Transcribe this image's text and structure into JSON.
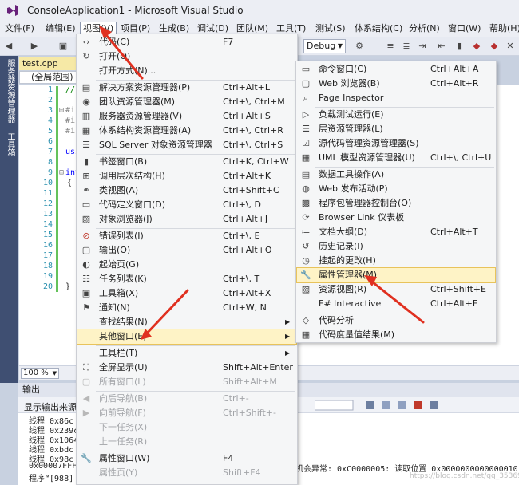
{
  "window": {
    "title": "ConsoleApplication1 - Microsoft Visual Studio"
  },
  "menubar": [
    "文件(F)",
    "编辑(E)",
    "视图(V)",
    "项目(P)",
    "生成(B)",
    "调试(D)",
    "团队(M)",
    "工具(T)",
    "测试(S)",
    "体系结构(C)",
    "分析(N)",
    "窗口(W)",
    "帮助(H)"
  ],
  "toolbar": {
    "config": "Debug"
  },
  "side_panels": [
    "服务器资源管理器",
    "工具箱"
  ],
  "editor": {
    "tab": "test.cpp",
    "scope": "(全局范围)",
    "line_numbers": [
      "1",
      "2",
      "3",
      "4",
      "5",
      "6",
      "7",
      "8",
      "9",
      "10",
      "11",
      "12",
      "13",
      "14",
      "15",
      "16",
      "17",
      "18",
      "19",
      "20"
    ],
    "code_fragments": [
      "//",
      "#ir",
      "#ir",
      "#ir",
      "usi",
      "int",
      "{",
      "}"
    ],
    "zoom": "100 %"
  },
  "view_menu": {
    "items": [
      {
        "label": "代码(C)",
        "shortcut": "F7",
        "icon": "code-icon"
      },
      {
        "label": "打开(O)",
        "shortcut": "",
        "icon": "open-icon"
      },
      {
        "label": "打开方式(N)...",
        "shortcut": "",
        "icon": ""
      },
      {
        "label": "解决方案资源管理器(P)",
        "shortcut": "Ctrl+Alt+L",
        "icon": "solution-explorer-icon"
      },
      {
        "label": "团队资源管理器(M)",
        "shortcut": "Ctrl+\\, Ctrl+M",
        "icon": "team-explorer-icon"
      },
      {
        "label": "服务器资源管理器(V)",
        "shortcut": "Ctrl+Alt+S",
        "icon": "server-explorer-icon"
      },
      {
        "label": "体系结构资源管理器(A)",
        "shortcut": "Ctrl+\\, Ctrl+R",
        "icon": "architecture-explorer-icon"
      },
      {
        "label": "SQL Server 对象资源管理器",
        "shortcut": "Ctrl+\\, Ctrl+S",
        "icon": "sql-server-icon"
      },
      {
        "label": "书签窗口(B)",
        "shortcut": "Ctrl+K, Ctrl+W",
        "icon": "bookmark-icon"
      },
      {
        "label": "调用层次结构(H)",
        "shortcut": "Ctrl+Alt+K",
        "icon": "call-hierarchy-icon"
      },
      {
        "label": "类视图(A)",
        "shortcut": "Ctrl+Shift+C",
        "icon": "class-view-icon"
      },
      {
        "label": "代码定义窗口(D)",
        "shortcut": "Ctrl+\\, D",
        "icon": "code-definition-icon"
      },
      {
        "label": "对象浏览器(J)",
        "shortcut": "Ctrl+Alt+J",
        "icon": "object-browser-icon"
      },
      {
        "label": "错误列表(I)",
        "shortcut": "Ctrl+\\, E",
        "icon": "error-list-icon"
      },
      {
        "label": "输出(O)",
        "shortcut": "Ctrl+Alt+O",
        "icon": "output-icon"
      },
      {
        "label": "起始页(G)",
        "shortcut": "",
        "icon": "start-page-icon"
      },
      {
        "label": "任务列表(K)",
        "shortcut": "Ctrl+\\, T",
        "icon": "task-list-icon"
      },
      {
        "label": "工具箱(X)",
        "shortcut": "Ctrl+Alt+X",
        "icon": "toolbox-icon"
      },
      {
        "label": "通知(N)",
        "shortcut": "Ctrl+W, N",
        "icon": "notification-icon"
      },
      {
        "label": "查找结果(N)",
        "shortcut": "",
        "icon": ""
      },
      {
        "label": "其他窗口(E)",
        "shortcut": "",
        "icon": ""
      },
      {
        "label": "工具栏(T)",
        "shortcut": "",
        "icon": ""
      },
      {
        "label": "全屏显示(U)",
        "shortcut": "Shift+Alt+Enter",
        "icon": "fullscreen-icon"
      },
      {
        "label": "所有窗口(L)",
        "shortcut": "Shift+Alt+M",
        "icon": "all-windows-icon"
      },
      {
        "label": "向后导航(B)",
        "shortcut": "Ctrl+-",
        "icon": "navigate-back-icon"
      },
      {
        "label": "向前导航(F)",
        "shortcut": "Ctrl+Shift+-",
        "icon": "navigate-forward-icon"
      },
      {
        "label": "下一任务(X)",
        "shortcut": "",
        "icon": ""
      },
      {
        "label": "上一任务(R)",
        "shortcut": "",
        "icon": ""
      },
      {
        "label": "属性窗口(W)",
        "shortcut": "F4",
        "icon": "properties-window-icon"
      },
      {
        "label": "属性页(Y)",
        "shortcut": "Shift+F4",
        "icon": ""
      }
    ]
  },
  "other_windows_menu": {
    "items": [
      {
        "label": "命令窗口(C)",
        "shortcut": "Ctrl+Alt+A",
        "icon": "command-window-icon"
      },
      {
        "label": "Web 浏览器(B)",
        "shortcut": "Ctrl+Alt+R",
        "icon": "web-browser-icon"
      },
      {
        "label": "Page Inspector",
        "shortcut": "",
        "icon": "page-inspector-icon"
      },
      {
        "label": "负载测试运行(E)",
        "shortcut": "",
        "icon": "load-test-icon"
      },
      {
        "label": "层资源管理器(L)",
        "shortcut": "",
        "icon": "layer-explorer-icon"
      },
      {
        "label": "源代码管理资源管理器(S)",
        "shortcut": "",
        "icon": "source-control-icon"
      },
      {
        "label": "UML 模型资源管理器(U)",
        "shortcut": "Ctrl+\\, Ctrl+U",
        "icon": "uml-model-icon"
      },
      {
        "label": "数据工具操作(A)",
        "shortcut": "",
        "icon": "data-tools-icon"
      },
      {
        "label": "Web 发布活动(P)",
        "shortcut": "",
        "icon": "web-publish-icon"
      },
      {
        "label": "程序包管理器控制台(O)",
        "shortcut": "",
        "icon": "package-manager-icon"
      },
      {
        "label": "Browser Link 仪表板",
        "shortcut": "",
        "icon": "browser-link-icon"
      },
      {
        "label": "文档大纲(D)",
        "shortcut": "Ctrl+Alt+T",
        "icon": "document-outline-icon"
      },
      {
        "label": "历史记录(I)",
        "shortcut": "",
        "icon": "history-icon"
      },
      {
        "label": "挂起的更改(H)",
        "shortcut": "",
        "icon": "pending-changes-icon"
      },
      {
        "label": "属性管理器(M)",
        "shortcut": "",
        "icon": "property-manager-icon"
      },
      {
        "label": "资源视图(R)",
        "shortcut": "Ctrl+Shift+E",
        "icon": "resource-view-icon"
      },
      {
        "label": "F# Interactive",
        "shortcut": "Ctrl+Alt+F",
        "icon": "fsharp-interactive-icon"
      },
      {
        "label": "代码分析",
        "shortcut": "",
        "icon": "code-analysis-icon"
      },
      {
        "label": "代码度量值结果(M)",
        "shortcut": "",
        "icon": "code-metrics-icon"
      }
    ]
  },
  "output": {
    "title": "输出",
    "source_label": "显示输出来源(S)",
    "lines": [
      "线程 0x86c",
      "线程 0x239c",
      "线程 0x1064",
      "线程 0xbdc",
      "线程 0x98c",
      "0x00007FFF24",
      "程序“[988]"
    ],
    "exception_text": "机会异常:  0xC0000005:  读取位置 0x0000000000000010"
  },
  "watermark": "https://blog.csdn.net/qq_35369091"
}
